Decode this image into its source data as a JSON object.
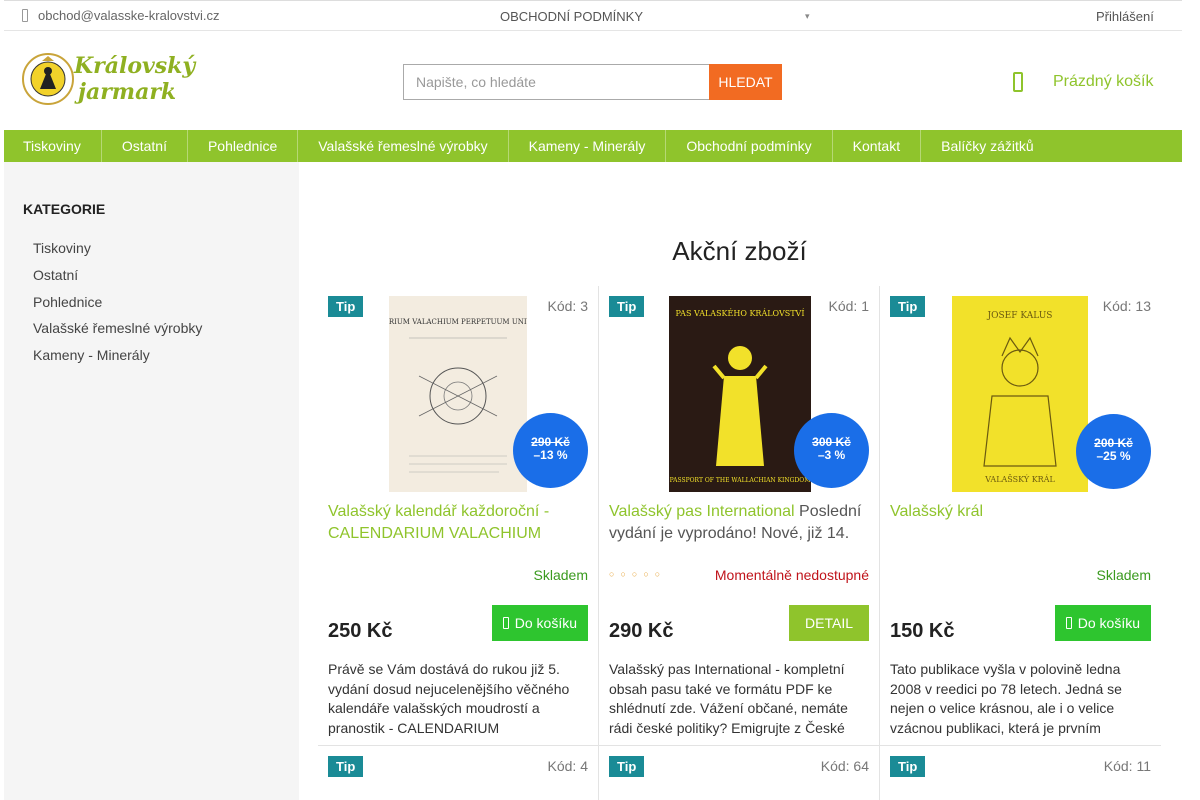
{
  "topbar": {
    "email": "obchod@valasske-kralovstvi.cz",
    "terms": "OBCHODNÍ PODMÍNKY",
    "login": "Přihlášení"
  },
  "logo": {
    "line1": "Královský",
    "line2": "jarmark"
  },
  "search": {
    "placeholder": "Napište, co hledáte",
    "button": "HLEDAT"
  },
  "cart": {
    "label": "Prázdný košík"
  },
  "nav": [
    "Tiskoviny",
    "Ostatní",
    "Pohlednice",
    "Valašské řemeslné výrobky",
    "Kameny - Minerály",
    "Obchodní podmínky",
    "Kontakt",
    "Balíčky zážitků"
  ],
  "sidebar": {
    "title": "KATEGORIE",
    "items": [
      "Tiskoviny",
      "Ostatní",
      "Pohlednice",
      "Valašské řemeslné výrobky",
      "Kameny - Minerály"
    ]
  },
  "main": {
    "title": "Akční zboží"
  },
  "products": [
    {
      "tip": "Tip",
      "code": "Kód: 3",
      "image_caption": "CALENDARIUM VALACHIUM PERPETUUM UNIVERSALIS",
      "old_price": "290 Kč",
      "discount": "–13 %",
      "name": "Valašský kalendář každoroční - CALENDARIUM VALACHIUM",
      "extra": "",
      "stock": "Skladem",
      "price": "250 Kč",
      "button": "Do košíku",
      "description": "Právě se Vám dostává do rukou již 5. vydání dosud nejucelenějšího věčného kalendáře valašských moudrostí a pranostik - CALENDARIUM"
    },
    {
      "tip": "Tip",
      "code": "Kód: 1",
      "image_caption": "PAS VALASKÉHO KRÁLOVSTVÍ",
      "image_caption2": "PASSPORT OF THE WALLACHIAN KINGDOM",
      "old_price": "300 Kč",
      "discount": "–3 %",
      "name": "Valašský pas International",
      "extra": "Poslední vydání je vyprodáno! Nové, již 14.",
      "stock": "Momentálně nedostupné",
      "price": "290 Kč",
      "button": "DETAIL",
      "description": "Valašský pas International - kompletní obsah pasu také ve formátu PDF ke shlédnutí zde. Vážení občané, nemáte rádi české politiky? Emigrujte z České"
    },
    {
      "tip": "Tip",
      "code": "Kód: 13",
      "image_caption": "JOSEF KALUS",
      "image_caption2": "VALAŠSKÝ KRÁL",
      "old_price": "200 Kč",
      "discount": "–25 %",
      "name": "Valašský král",
      "extra": "",
      "stock": "Skladem",
      "price": "150 Kč",
      "button": "Do košíku",
      "description": "Tato publikace vyšla v polovině ledna 2008 v reedici po 78 letech. Jedná se nejen o velice krásnou, ale i o velice vzácnou publikaci, která je prvním"
    }
  ],
  "row2": [
    {
      "tip": "Tip",
      "code": "Kód: 4"
    },
    {
      "tip": "Tip",
      "code": "Kód: 64"
    },
    {
      "tip": "Tip",
      "code": "Kód: 11"
    }
  ],
  "colors": {
    "accent_green": "#8fc42c",
    "button_green": "#2ec52f",
    "search_orange": "#f26b22",
    "tip_teal": "#1a8b96",
    "badge_blue": "#1a6ee8",
    "out_of_stock_red": "#c0141b"
  }
}
